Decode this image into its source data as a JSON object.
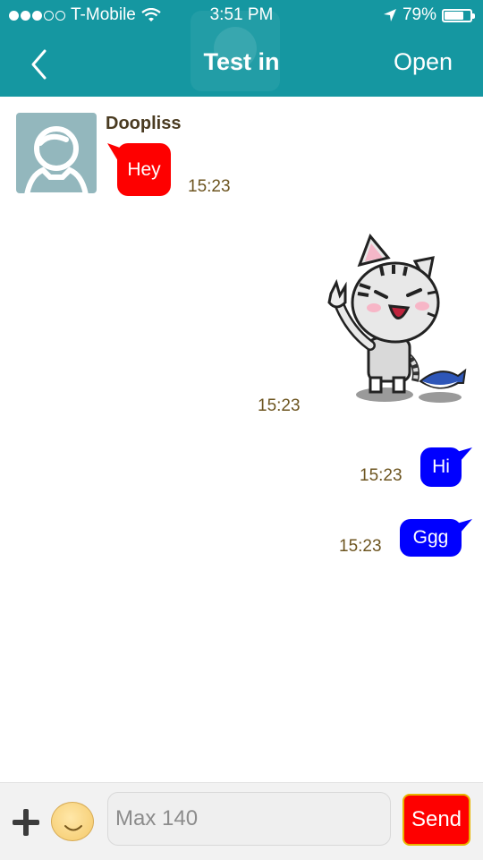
{
  "status_bar": {
    "carrier": "T-Mobile",
    "time": "3:51 PM",
    "battery": "79%",
    "battery_level": 0.79
  },
  "nav": {
    "title": "Test in",
    "action": "Open"
  },
  "chat": {
    "sender_name": "Doopliss",
    "messages": [
      {
        "direction": "incoming",
        "text": "Hey",
        "time": "15:23",
        "color": "#fe0000"
      },
      {
        "direction": "outgoing",
        "kind": "sticker",
        "sticker": "waving-cat",
        "time": "15:23"
      },
      {
        "direction": "outgoing",
        "text": "Hi",
        "time": "15:23",
        "color": "#0000ff"
      },
      {
        "direction": "outgoing",
        "text": "Ggg",
        "time": "15:23",
        "color": "#0000ff"
      }
    ]
  },
  "input": {
    "placeholder": "Max 140",
    "send_label": "Send"
  },
  "colors": {
    "header": "#1597a1",
    "incoming_bubble": "#fe0000",
    "outgoing_bubble": "#0000ff",
    "timestamp": "#6d5520",
    "send_button": "#fe0000"
  }
}
